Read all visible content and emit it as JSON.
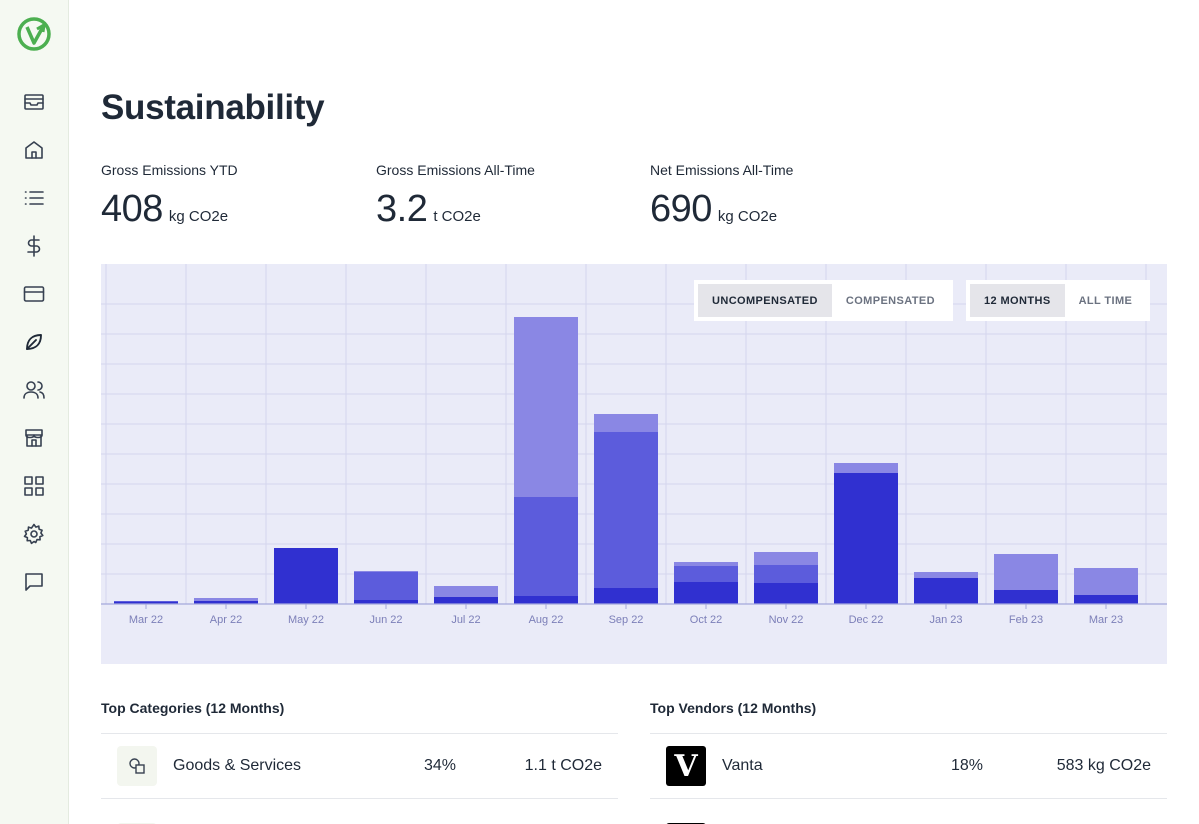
{
  "page": {
    "title": "Sustainability"
  },
  "sidebar": {
    "items": [
      {
        "icon": "inbox-icon"
      },
      {
        "icon": "home-icon"
      },
      {
        "icon": "list-icon"
      },
      {
        "icon": "dollar-icon"
      },
      {
        "icon": "credit-card-icon"
      },
      {
        "icon": "leaf-icon"
      },
      {
        "icon": "users-icon"
      },
      {
        "icon": "store-icon"
      },
      {
        "icon": "grid-icon"
      },
      {
        "icon": "gear-icon"
      },
      {
        "icon": "message-icon"
      }
    ]
  },
  "stats": [
    {
      "label": "Gross Emissions YTD",
      "value": "408",
      "unit": "kg CO2e"
    },
    {
      "label": "Gross Emissions All-Time",
      "value": "3.2",
      "unit": "t CO2e"
    },
    {
      "label": "Net Emissions All-Time",
      "value": "690",
      "unit": "kg CO2e"
    }
  ],
  "toggles": {
    "compensation": {
      "options": [
        "UNCOMPENSATED",
        "COMPENSATED"
      ],
      "selected": "UNCOMPENSATED"
    },
    "range": {
      "options": [
        "12 MONTHS",
        "ALL TIME"
      ],
      "selected": "12 MONTHS"
    }
  },
  "colors": {
    "dark": "#3030d0",
    "mid": "#5c5cdc",
    "light": "#8a87e4",
    "panel": "#eaebf8",
    "grid": "#d4d6ee"
  },
  "chart_data": {
    "type": "bar",
    "stacked": true,
    "categories": [
      "Mar 22",
      "Apr 22",
      "May 22",
      "Jun 22",
      "Jul 22",
      "Aug 22",
      "Sep 22",
      "Oct 22",
      "Nov 22",
      "Dec 22",
      "Jan 23",
      "Feb 23",
      "Mar 23"
    ],
    "series": [
      {
        "values": [
          2,
          3,
          56,
          4,
          7,
          8,
          16,
          22,
          21,
          131,
          26,
          14,
          9
        ],
        "color": "#3030d0"
      },
      {
        "values": [
          1,
          0,
          0,
          28,
          0,
          99,
          156,
          16,
          18,
          0,
          0,
          0,
          0
        ],
        "color": "#5c5cdc"
      },
      {
        "values": [
          0,
          3,
          0,
          1,
          11,
          180,
          18,
          4,
          13,
          10,
          6,
          36,
          27
        ],
        "color": "#8a87e4"
      }
    ],
    "ylim": [
      0,
      300
    ],
    "grid": true
  },
  "top_categories": {
    "title": "Top Categories (12 Months)",
    "rows": [
      {
        "name": "Goods & Services",
        "pct": "34%",
        "amount": "1.1 t CO2e"
      }
    ]
  },
  "top_vendors": {
    "title": "Top Vendors (12 Months)",
    "rows": [
      {
        "logo": "V",
        "name": "Vanta",
        "pct": "18%",
        "amount": "583 kg CO2e"
      }
    ]
  }
}
